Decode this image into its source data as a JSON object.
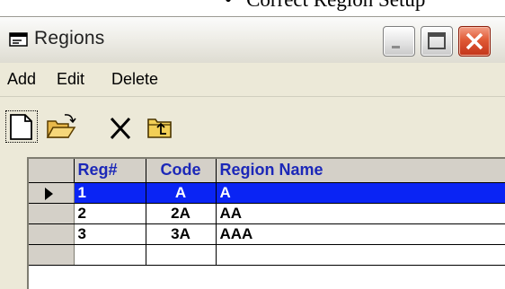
{
  "document": {
    "bullet": "•",
    "caption": "Correct Region Setup"
  },
  "window": {
    "title": "Regions",
    "title_icon": "window-app-icon",
    "controls": [
      "minimize-icon",
      "maximize-icon",
      "close-icon"
    ]
  },
  "menu": {
    "items": [
      "Add",
      "Edit",
      "Delete"
    ]
  },
  "toolbar": {
    "icons": [
      "new-document-icon",
      "open-folder-icon",
      "delete-x-icon",
      "up-folder-icon"
    ]
  },
  "grid": {
    "headers": {
      "reg": "Reg#",
      "code": "Code",
      "name": "Region Name"
    },
    "rows": [
      {
        "reg": "1",
        "code": "A",
        "name": "A",
        "selected": true
      },
      {
        "reg": "2",
        "code": "2A",
        "name": "AA",
        "selected": false
      },
      {
        "reg": "3",
        "code": "3A",
        "name": "AAA",
        "selected": false
      },
      {
        "reg": "",
        "code": "",
        "name": "",
        "selected": false
      }
    ]
  },
  "colors": {
    "selection": "#0a24f4",
    "header_text": "#1c28b8",
    "close_button": "#e05a36"
  }
}
